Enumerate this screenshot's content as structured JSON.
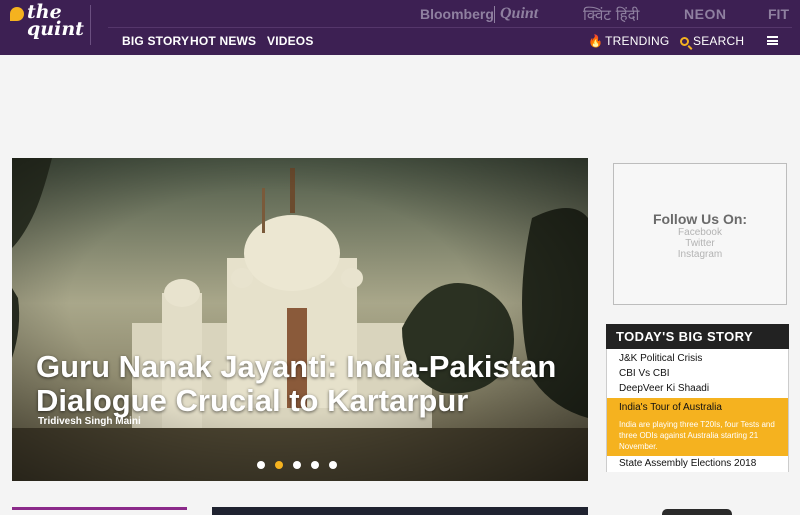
{
  "brand": {
    "logo_text": "the\nquint"
  },
  "partners": {
    "bloomberg": "Bloomberg",
    "quint": "Quint",
    "hindi": "क्विंट हिंदी",
    "neon": "NEON",
    "fit": "FIT"
  },
  "nav": {
    "big_story": "BIG STORY",
    "hot_news": "HOT NEWS",
    "videos": "VIDEOS",
    "trending": "TRENDING",
    "search": "SEARCH"
  },
  "hero": {
    "title": "Guru Nanak Jayanti: India-Pakistan Dialogue Crucial to Kartarpur",
    "author": "Tridivesh Singh Maini",
    "slide_count": 5,
    "active_slide": 2
  },
  "follow": {
    "title": "Follow Us On:",
    "links": [
      "Facebook",
      "Twitter",
      "Instagram"
    ]
  },
  "big_story": {
    "heading": "TODAY'S BIG STORY",
    "items": [
      "J&K Political Crisis",
      "CBI Vs CBI",
      "DeepVeer Ki Shaadi"
    ],
    "active_title": "India's Tour of Australia",
    "active_desc": "India are playing three T20Is, four Tests and three ODIs against Australia starting 21 November.",
    "last_item": "State Assembly Elections 2018"
  },
  "colors": {
    "header_bg": "#3d2053",
    "accent": "#f5b21f",
    "big_story_head": "#222222"
  },
  "icons": [
    "flame-icon",
    "search-icon",
    "hamburger-menu-icon"
  ]
}
